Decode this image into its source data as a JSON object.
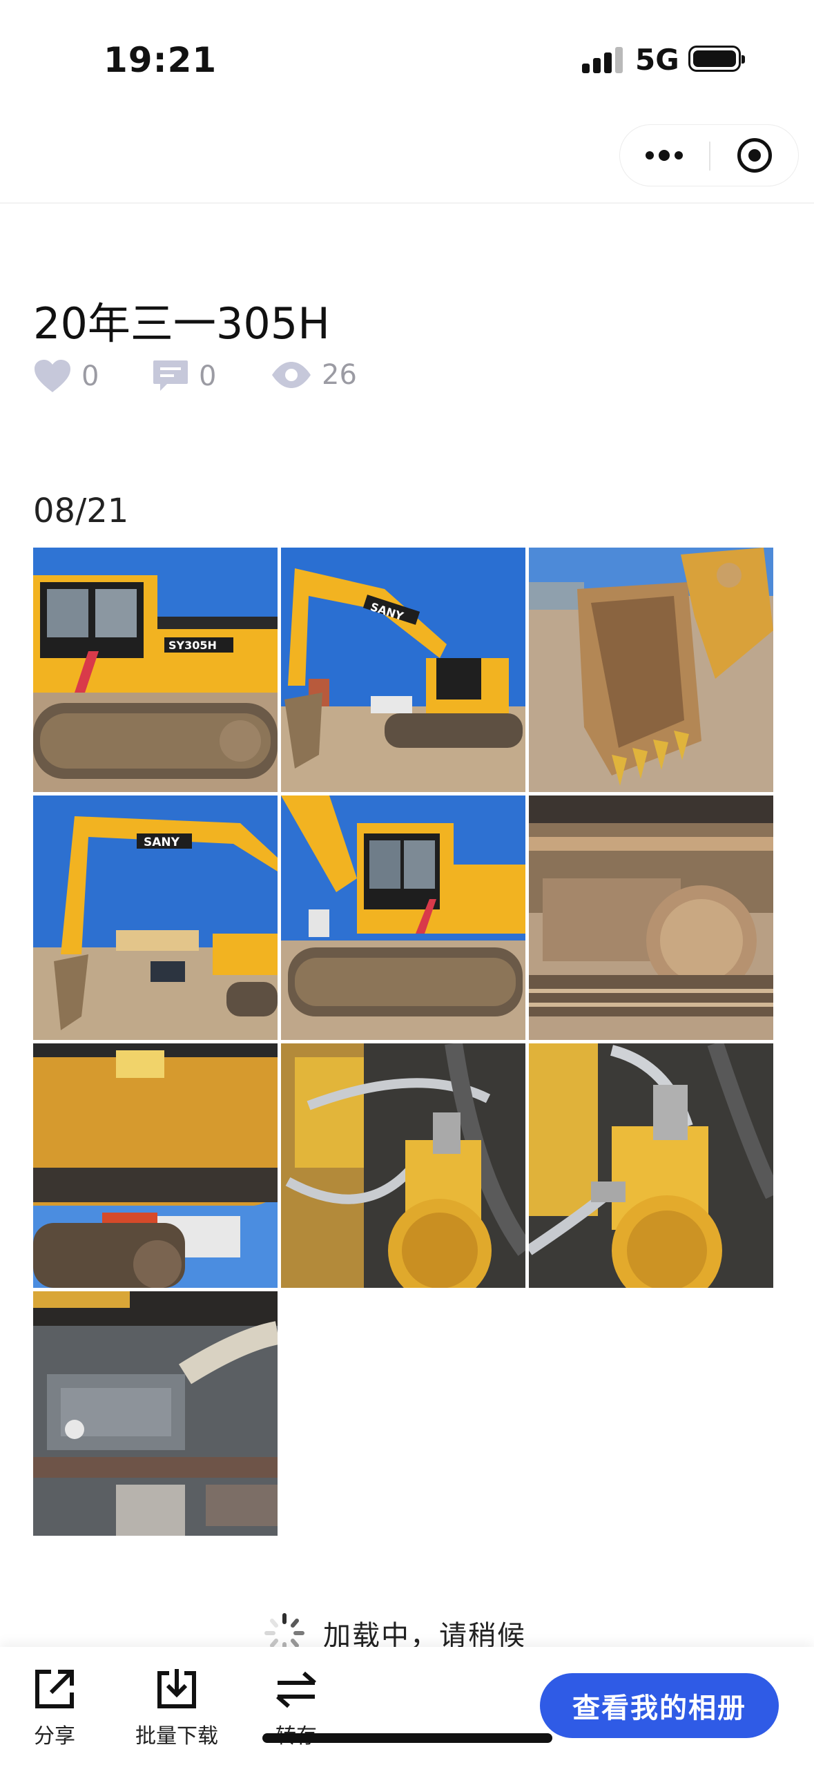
{
  "status_bar": {
    "time": "19:21",
    "network": "5G",
    "icons": [
      "signal-icon",
      "battery-icon"
    ]
  },
  "capsule": {
    "icons": [
      "more-dots-icon",
      "close-target-icon"
    ]
  },
  "album": {
    "title": "20年三一305H",
    "likes": "0",
    "comments": "0",
    "views": "26",
    "stat_icons": [
      "heart-icon",
      "comment-icon",
      "eye-icon"
    ]
  },
  "section": {
    "date": "08/21",
    "photo_count": 10,
    "photos": [
      {
        "subject": "excavator cab side",
        "label": "SY305H"
      },
      {
        "subject": "excavator arm raised",
        "label": "SANY"
      },
      {
        "subject": "bucket teeth close-up",
        "label": ""
      },
      {
        "subject": "excavator full boom",
        "label": "SANY"
      },
      {
        "subject": "excavator cab front",
        "label": ""
      },
      {
        "subject": "track undercarriage",
        "label": ""
      },
      {
        "subject": "counterweight rear",
        "label": ""
      },
      {
        "subject": "swing motor hoses",
        "label": ""
      },
      {
        "subject": "swing motor close-up",
        "label": ""
      },
      {
        "subject": "engine compartment",
        "label": ""
      }
    ]
  },
  "loading": {
    "text": "加载中，请稍候"
  },
  "toolbar": {
    "share_label": "分享",
    "download_label": "批量下载",
    "transfer_label": "转存",
    "cta_label": "查看我的相册"
  },
  "colors": {
    "accent": "#2f5be6",
    "stat_gray": "#9b9ba3",
    "excavator_yellow": "#f2b321",
    "sky_blue": "#3a7fd8"
  }
}
